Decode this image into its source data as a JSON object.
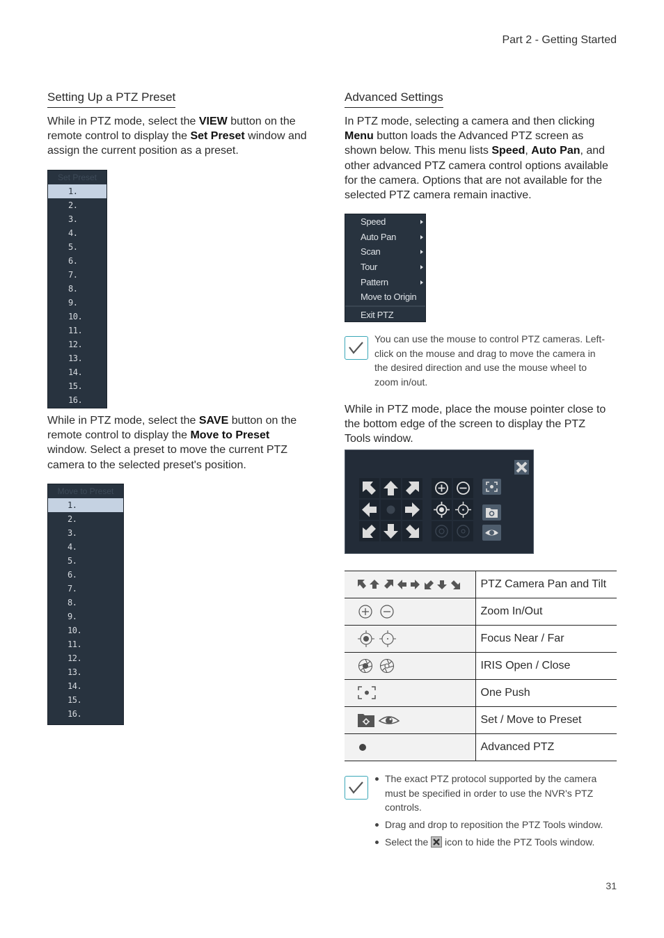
{
  "header": {
    "section": "Part 2 - Getting Started",
    "page_number": "31"
  },
  "left": {
    "title": "Setting Up a PTZ Preset",
    "intro": {
      "t1": "While in PTZ mode, select the ",
      "b1": "VIEW",
      "t2": " button on the remote control to display the ",
      "b2": "Set Preset",
      "t3": " window and assign the current position as a preset."
    },
    "set_preset": {
      "title": "Set Preset",
      "selected_index": 0,
      "items": [
        "1.",
        "2.",
        "3.",
        "4.",
        "5.",
        "6.",
        "7.",
        "8.",
        "9.",
        "10.",
        "11.",
        "12.",
        "13.",
        "14.",
        "15.",
        "16."
      ]
    },
    "save_para": {
      "t1": "While in PTZ mode, select the ",
      "b1": "SAVE",
      "t2": " button on the remote control to display the ",
      "b2": "Move to Preset",
      "t3": " window. Select a preset to move the current PTZ camera to the selected preset's position."
    },
    "move_preset": {
      "title": "Move to Preset",
      "selected_index": 0,
      "items": [
        "1.",
        "2.",
        "3.",
        "4.",
        "5.",
        "6.",
        "7.",
        "8.",
        "9.",
        "10.",
        "11.",
        "12.",
        "13.",
        "14.",
        "15.",
        "16."
      ]
    }
  },
  "right": {
    "title": "Advanced Settings",
    "intro": {
      "t1": "In PTZ mode, selecting a camera and then clicking ",
      "b1": "Menu",
      "t2": " button loads the Advanced PTZ screen as shown below. This menu lists ",
      "b2": "Speed",
      "t3": ", ",
      "b3": "Auto Pan",
      "t4": ", and other advanced PTZ camera control options available for the camera. Options that are not available for the selected PTZ camera remain inactive."
    },
    "menu": {
      "items": [
        {
          "label": "Speed",
          "submenu": true
        },
        {
          "label": "Auto Pan",
          "submenu": true
        },
        {
          "label": "Scan",
          "submenu": true
        },
        {
          "label": "Tour",
          "submenu": true
        },
        {
          "label": "Pattern",
          "submenu": true
        },
        {
          "label": "Move to Origin",
          "submenu": false
        }
      ],
      "exit": "Exit PTZ"
    },
    "note1": "You can use the mouse to control PTZ cameras. Left-click on the mouse and drag to move the camera in the desired direction and use the mouse wheel to zoom in/out.",
    "tools_para": "While in PTZ mode, place the mouse pointer close to the bottom edge of the screen to display the PTZ Tools window.",
    "ptz_tools": {
      "icons": [
        "arrow-up-left",
        "arrow-up",
        "arrow-up-right",
        "arrow-left",
        "advanced-ptz-dot",
        "arrow-right",
        "arrow-down-left",
        "arrow-down",
        "arrow-down-right",
        "zoom-in",
        "zoom-out",
        "focus-near",
        "focus-far",
        "iris-open",
        "iris-close",
        "one-push",
        "set-preset",
        "move-to-preset",
        "close"
      ],
      "inactive": [
        "iris-open",
        "iris-close"
      ]
    },
    "legend": [
      {
        "icons": "pan-tilt-arrows",
        "label": "PTZ Camera Pan and Tilt"
      },
      {
        "icons": "zoom-in-out",
        "label": "Zoom In/Out"
      },
      {
        "icons": "focus-near-far",
        "label": "Focus Near / Far"
      },
      {
        "icons": "iris-open-close",
        "label": "IRIS Open / Close"
      },
      {
        "icons": "one-push",
        "label": "One Push"
      },
      {
        "icons": "set-move-preset",
        "label": "Set / Move to Preset"
      },
      {
        "icons": "advanced-ptz",
        "label": "Advanced PTZ"
      }
    ],
    "note2": {
      "b1": "The exact PTZ protocol supported by the camera must be specified in order to use the NVR's PTZ controls.",
      "b2": "Drag and drop to reposition the PTZ Tools window.",
      "b3_pre": "Select the ",
      "b3_post": " icon to hide the PTZ Tools window."
    }
  },
  "colors": {
    "panel_bg": "#28333f",
    "selected_row": "#c5d2e2",
    "check_accent": "#3aa7b8",
    "tools_bg": "#232c38"
  }
}
